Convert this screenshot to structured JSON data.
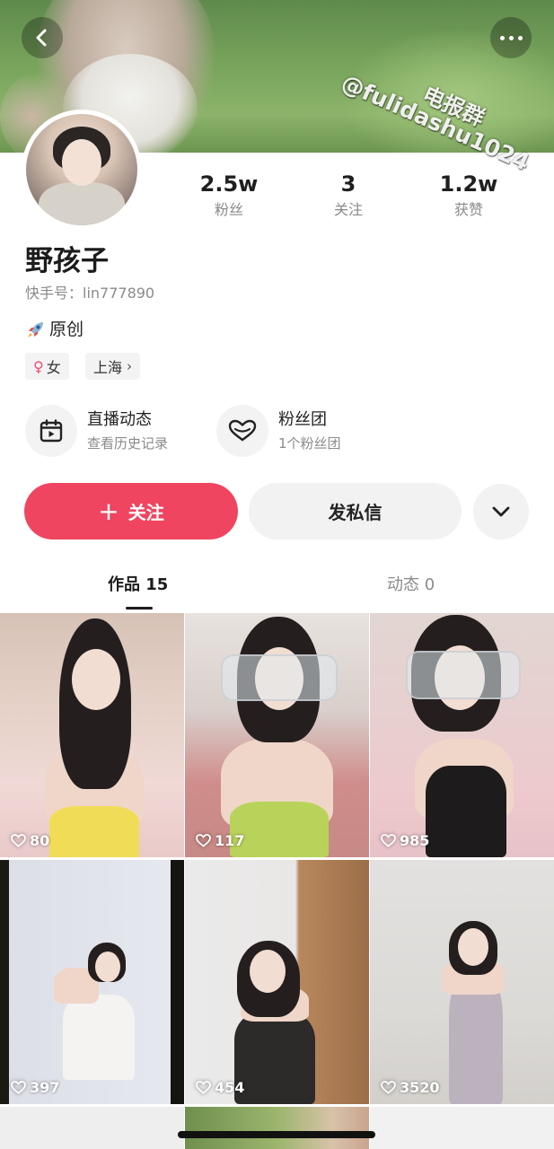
{
  "header": {
    "back_icon": "chevron-left-icon",
    "more_icon": "more-dots-icon",
    "watermark_line1": "电报群",
    "watermark_line2": "@fulidashu1024"
  },
  "profile": {
    "nickname": "野孩子",
    "account_id": "快手号：lin777890",
    "bio_icon": "rocket-icon",
    "bio": "原创",
    "gender_symbol": "♀",
    "gender": "女",
    "city": "上海",
    "city_chevron": "›"
  },
  "stats": {
    "fans": {
      "value": "2.5w",
      "label": "粉丝"
    },
    "following": {
      "value": "3",
      "label": "关注"
    },
    "likes": {
      "value": "1.2w",
      "label": "获赞"
    }
  },
  "features": {
    "live": {
      "title": "直播动态",
      "subtitle": "查看历史记录",
      "icon": "calendar-play-icon"
    },
    "fan_group": {
      "title": "粉丝团",
      "subtitle": "1个粉丝团",
      "icon": "heart-outline-icon"
    }
  },
  "actions": {
    "follow_plus": "+",
    "follow_label": "关注",
    "message_label": "发私信",
    "more_icon": "chevron-down-icon"
  },
  "tabs": {
    "works": "作品 15",
    "moments": "动态 0"
  },
  "videos": [
    {
      "likes": "80"
    },
    {
      "likes": "117"
    },
    {
      "likes": "985"
    },
    {
      "likes": "397"
    },
    {
      "likes": "454"
    },
    {
      "likes": "3520"
    }
  ],
  "colors": {
    "accent": "#ef4560",
    "gender_pink": "#ef4b73",
    "muted_text": "#8a8a8a",
    "chip_bg": "#f3f3f3"
  }
}
